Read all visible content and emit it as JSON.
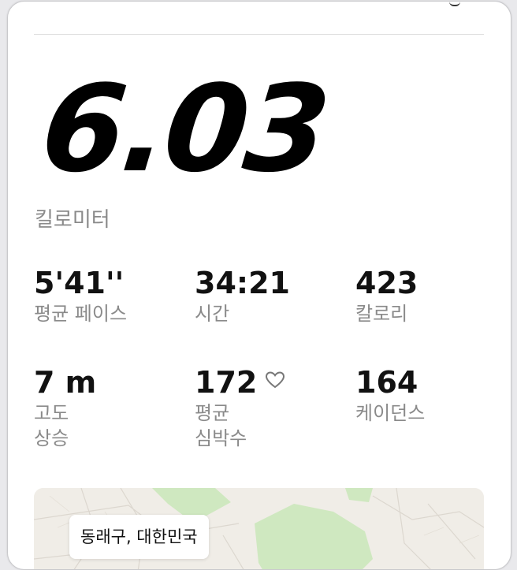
{
  "summary": {
    "distance_value": "6.03",
    "distance_unit": "킬로미터"
  },
  "stats": {
    "pace": {
      "value": "5'41''",
      "label": "평균 페이스"
    },
    "time": {
      "value": "34:21",
      "label": "시간"
    },
    "calories": {
      "value": "423",
      "label": "칼로리"
    },
    "elevation": {
      "value": "7 m",
      "label_line1": "고도",
      "label_line2": "상승"
    },
    "heart_rate": {
      "value": "172",
      "label_line1": "평균",
      "label_line2": "심박수",
      "icon": "heart-outline-icon"
    },
    "cadence": {
      "value": "164",
      "label": "케이던스"
    }
  },
  "map": {
    "location": "동래구, 대한민국"
  },
  "colors": {
    "map_land": "#f0ede7",
    "map_park": "#cfe8c0",
    "label_gray": "#8a8a8a"
  }
}
